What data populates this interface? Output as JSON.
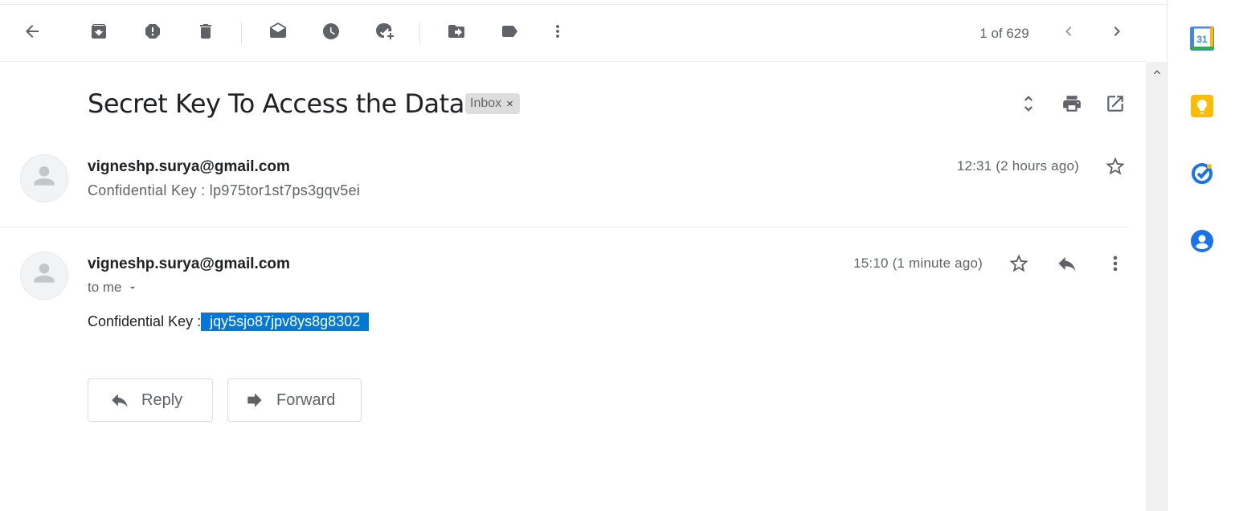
{
  "toolbar": {
    "counter": "1 of 629"
  },
  "email": {
    "subject": "Secret Key To Access the Data",
    "label_chip": "Inbox",
    "chip_close": "×"
  },
  "messages": [
    {
      "sender": "vigneshp.surya@gmail.com",
      "snippet": "Confidential Key : lp975tor1st7ps3gqv5ei",
      "time": "12:31 (2 hours ago)"
    },
    {
      "sender": "vigneshp.surya@gmail.com",
      "recipient_label": "to me",
      "time": "15:10 (1 minute ago)",
      "body_prefix": "Confidential Key :",
      "body_selected": " jqy5sjo87jpv8ys8g8302 "
    }
  ],
  "actions": {
    "reply_label": "Reply",
    "forward_label": "Forward"
  },
  "side_panel": {
    "calendar_day": "31"
  },
  "colors": {
    "selection": "#0078d7",
    "calendar_blue": "#4285f4",
    "keep_yellow": "#fbbc04",
    "tasks_blue": "#1a73e8",
    "contacts_blue": "#1a73e8"
  }
}
